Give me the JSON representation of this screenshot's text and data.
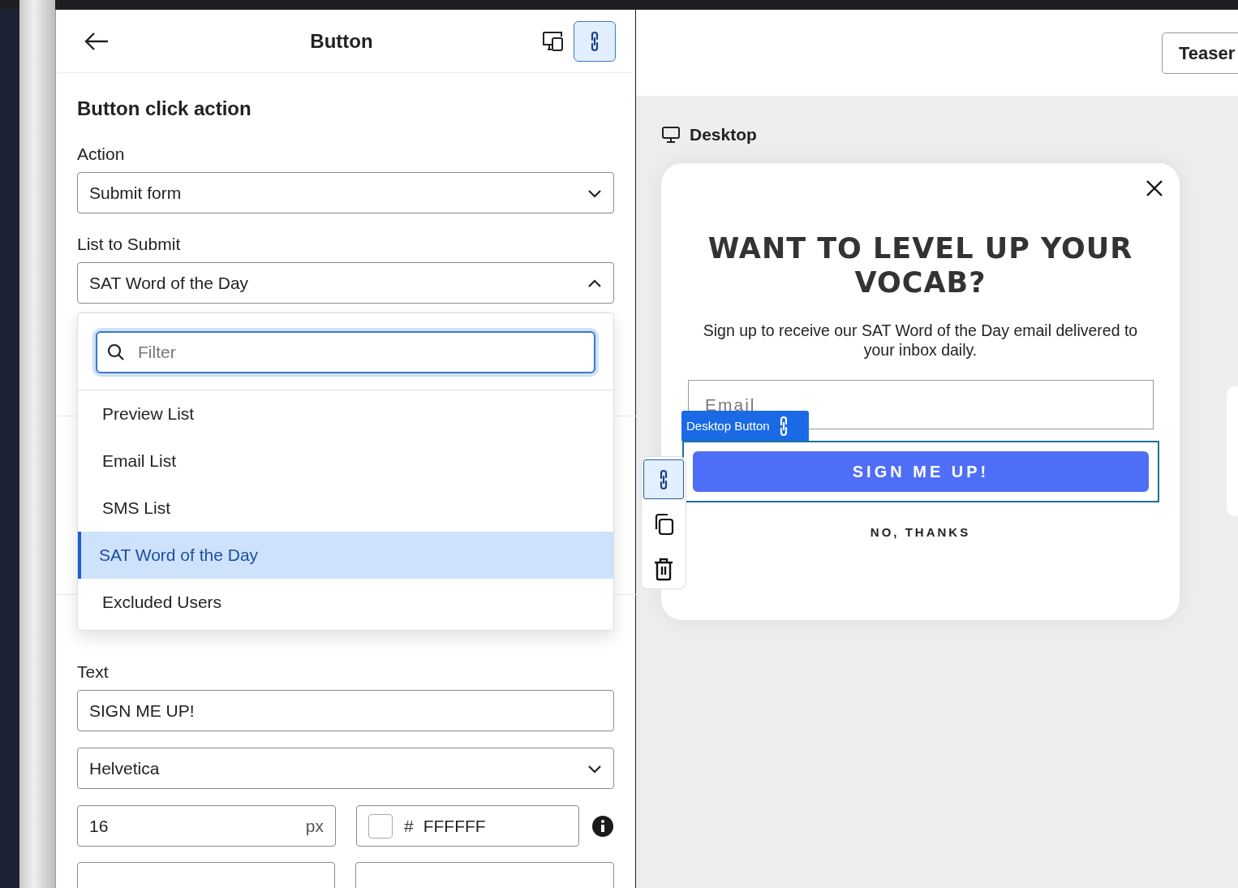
{
  "panel": {
    "title": "Button",
    "section_title": "Button click action",
    "action": {
      "label": "Action",
      "value": "Submit form",
      "expanded": false
    },
    "list": {
      "label": "List to Submit",
      "value": "SAT Word of the Day",
      "expanded": true
    },
    "dropdown": {
      "search": {
        "placeholder": "Filter"
      },
      "options": [
        {
          "label": "Preview List",
          "selected": false
        },
        {
          "label": "Email List",
          "selected": false
        },
        {
          "label": "SMS List",
          "selected": false
        },
        {
          "label": "SAT Word of the Day",
          "selected": true
        },
        {
          "label": "Excluded Users",
          "selected": false
        }
      ]
    },
    "text_label": "Text",
    "text_value": "SIGN ME UP!",
    "font": "Helvetica",
    "size": "16",
    "size_unit": "px",
    "color_hash": "#",
    "color_value": "FFFFFF"
  },
  "preview": {
    "teaser_button": "Teaser",
    "device": "Desktop",
    "popup": {
      "title": "WANT TO LEVEL UP YOUR VOCAB?",
      "subtitle": "Sign up to receive our SAT Word of the Day email delivered to your inbox daily.",
      "email_placeholder": "Email",
      "tag": "Desktop Button",
      "button": "SIGN ME UP!",
      "decline": "NO, THANKS"
    }
  }
}
